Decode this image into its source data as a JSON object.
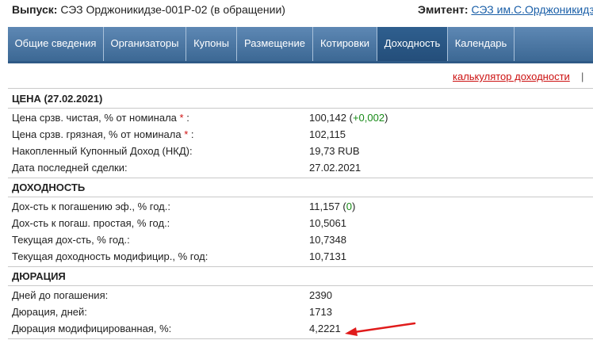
{
  "header": {
    "issue_label": "Выпуск:",
    "issue_value": "СЭЗ Орджоникидзе-001Р-02 (в обращении)",
    "issuer_label": "Эмитент:",
    "issuer_link": "СЭЗ им.С.Орджоникидз"
  },
  "tabs": [
    {
      "label": "Общие сведения",
      "active": false
    },
    {
      "label": "Организаторы",
      "active": false
    },
    {
      "label": "Купоны",
      "active": false
    },
    {
      "label": "Размещение",
      "active": false
    },
    {
      "label": "Котировки",
      "active": false
    },
    {
      "label": "Доходность",
      "active": true
    },
    {
      "label": "Календарь",
      "active": false
    }
  ],
  "topbar": {
    "calc_link": "калькулятор доходности",
    "separator": "|"
  },
  "price": {
    "title": "ЦЕНА (27.02.2021)",
    "rows": [
      {
        "label": "Цена срзв. чистая, % от номинала",
        "star": "*",
        "colon": ":",
        "value": "100,142",
        "change": "+0,002"
      },
      {
        "label": "Цена срзв. грязная, % от номинала",
        "star": "*",
        "colon": ":",
        "value": "102,115"
      },
      {
        "label": "Накопленный Купонный Доход (НКД):",
        "value": "19,73 RUB"
      },
      {
        "label": "Дата последней сделки:",
        "value": "27.02.2021"
      }
    ]
  },
  "yield": {
    "title": "ДОХОДНОСТЬ",
    "rows": [
      {
        "label": "Дох-сть к погашению эф., % год.:",
        "value": "11,157",
        "change": "0"
      },
      {
        "label": "Дох-сть к погаш. простая, % год.:",
        "value": "10,5061"
      },
      {
        "label": "Текущая дох-сть, % год.:",
        "value": "10,7348"
      },
      {
        "label": "Текущая доходность модифицир., % год:",
        "value": "10,7131"
      }
    ]
  },
  "duration": {
    "title": "ДЮРАЦИЯ",
    "rows": [
      {
        "label": "Дней до погашения:",
        "value": "2390"
      },
      {
        "label": "Дюрация, дней:",
        "value": "1713"
      },
      {
        "label": "Дюрация модифицированная, %:",
        "value": "4,2221"
      }
    ]
  },
  "colors": {
    "tab_bar": "#4a76a3",
    "tab_active": "#2a5684",
    "link_red": "#cc1111",
    "link_blue": "#1a5fa8",
    "change_green": "#178a17",
    "arrow_red": "#e01b1b"
  },
  "icons": {
    "annotation": "red-arrow-icon"
  }
}
